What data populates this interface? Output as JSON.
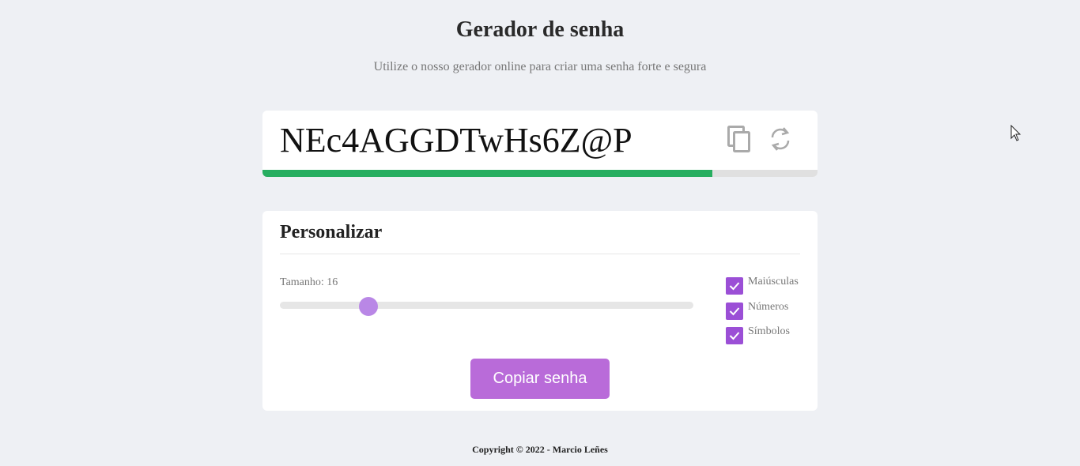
{
  "header": {
    "title": "Gerador de senha",
    "subtitle": "Utilize o nosso gerador online para criar uma senha forte e segura"
  },
  "password": {
    "value": "NEc4AGGDTwHs6Z@P",
    "strength_fraction": 0.81,
    "strength_color": "#27ae60",
    "copy_icon": "copy-icon",
    "refresh_icon": "refresh-icon"
  },
  "customize": {
    "title": "Personalizar",
    "length_label": "Tamanho: 16",
    "length_value": 16,
    "slider_fraction": 0.214,
    "options": [
      {
        "label": "Maiúsculas",
        "checked": true
      },
      {
        "label": "Números",
        "checked": true
      },
      {
        "label": "Símbolos",
        "checked": true
      }
    ],
    "copy_button_label": "Copiar senha"
  },
  "footer": {
    "copyright": "Copyright © 2022 - Marcio Leñes"
  },
  "colors": {
    "accent": "#9b4fd6",
    "button": "#b96bd9",
    "background": "#eef0f4"
  }
}
